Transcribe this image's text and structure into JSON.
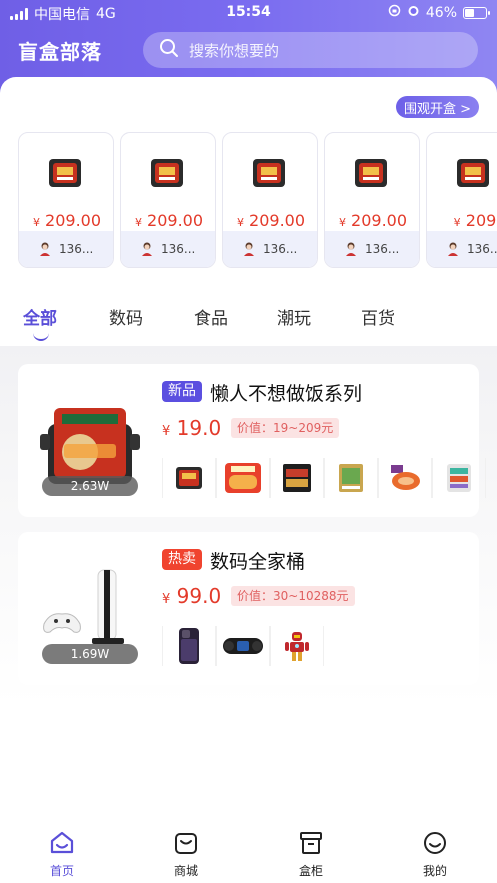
{
  "status_bar": {
    "carrier": "中国电信",
    "network": "4G",
    "time": "15:54",
    "battery": "46%",
    "battery_level": 0.46
  },
  "header": {
    "title": "盲盒部落",
    "search_placeholder": "搜索你想要的"
  },
  "feed": {
    "watch_button": "围观开盒 >",
    "cards": [
      {
        "price_symbol": "¥",
        "price": "209.00",
        "user": "136..."
      },
      {
        "price_symbol": "¥",
        "price": "209.00",
        "user": "136..."
      },
      {
        "price_symbol": "¥",
        "price": "209.00",
        "user": "136..."
      },
      {
        "price_symbol": "¥",
        "price": "209.00",
        "user": "136..."
      },
      {
        "price_symbol": "¥",
        "price": "209",
        "user": "136..."
      }
    ]
  },
  "tabs": [
    {
      "label": "全部",
      "active": true
    },
    {
      "label": "数码",
      "active": false
    },
    {
      "label": "食品",
      "active": false
    },
    {
      "label": "潮玩",
      "active": false
    },
    {
      "label": "百货",
      "active": false
    }
  ],
  "boxes": [
    {
      "tag": "新品",
      "title": "懒人不想做饭系列",
      "price_symbol": "¥",
      "price": "19.0",
      "value": "价值：19~209元",
      "count": "2.63W",
      "items": [
        "hotpot-icon",
        "noodles-icon",
        "instant-noodle-icon",
        "snack-bag-icon",
        "spicy-strips-icon",
        "snack-pack-icon"
      ]
    },
    {
      "tag": "热卖",
      "title": "数码全家桶",
      "price_symbol": "¥",
      "price": "99.0",
      "value": "价值：30~10288元",
      "count": "1.69W",
      "items": [
        "phone-icon",
        "speaker-icon",
        "robot-figure-icon"
      ]
    }
  ],
  "bottom_nav": [
    {
      "label": "首页",
      "icon": "home-icon",
      "active": true
    },
    {
      "label": "商城",
      "icon": "shop-bag-icon",
      "active": false
    },
    {
      "label": "盒柜",
      "icon": "box-cabinet-icon",
      "active": false
    },
    {
      "label": "我的",
      "icon": "smile-icon",
      "active": false
    }
  ],
  "colors": {
    "brand": "#6f5fe6",
    "price_red": "#e33a2a",
    "tag_new": "#5b4fe0",
    "tag_hot": "#f0442f"
  }
}
